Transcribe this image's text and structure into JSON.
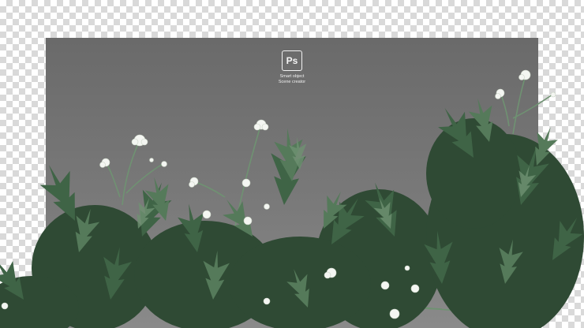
{
  "scene": {
    "background": "transparency-checkerboard",
    "panel_color": "#777777",
    "foliage_colors": [
      "#2f4a34",
      "#3f6446",
      "#557a5a",
      "#6f9272"
    ],
    "flower_color": "#f4f6f2"
  },
  "badge": {
    "icon": "photoshop-icon",
    "label": "Ps",
    "line1": "Smart object",
    "line2": "Scene creator"
  }
}
